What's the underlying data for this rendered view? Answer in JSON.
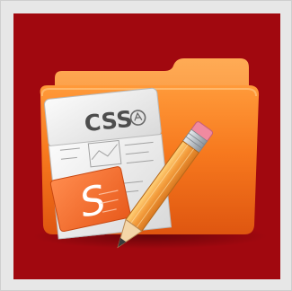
{
  "tile": {
    "background": "#a1080f"
  },
  "icon": {
    "name": "css-editor-folder-icon",
    "sheet_title": "CSS",
    "card_letter": "S",
    "colors": {
      "folder": "#f7791e",
      "folder_light": "#ffab55",
      "folder_dark": "#df5610",
      "paper": "#eeeeee",
      "card": "#f46d2b",
      "pencil_body": "#f39c3c",
      "pencil_ferrule": "#b8bec4",
      "pencil_eraser": "#f08aa0"
    }
  }
}
